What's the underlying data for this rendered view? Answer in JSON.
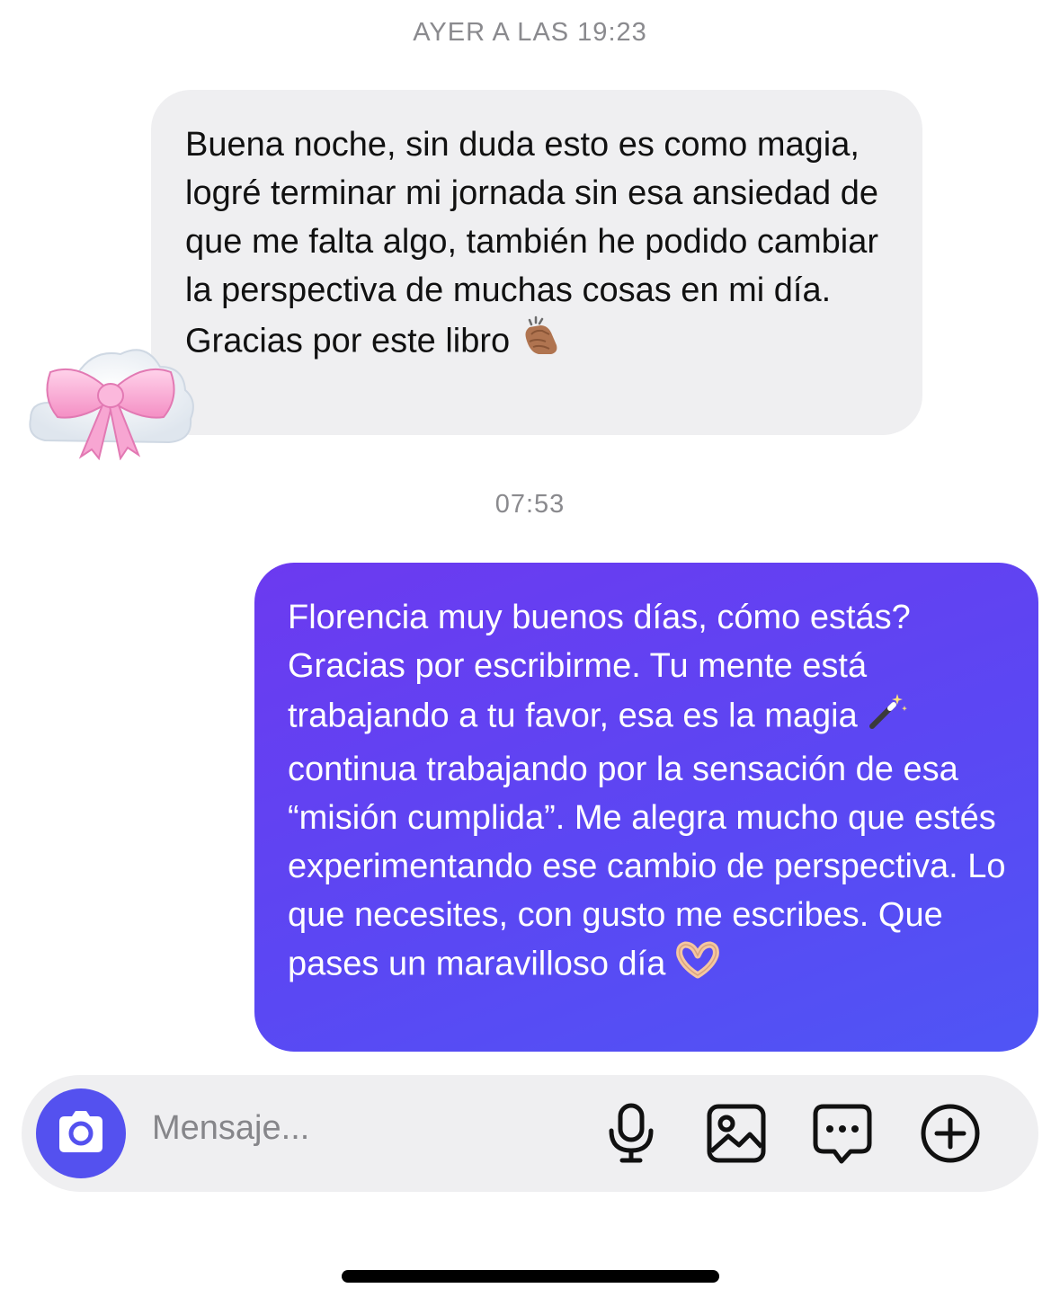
{
  "thread": {
    "timestamp_1": "AYER A LAS 19:23",
    "timestamp_2": "07:53"
  },
  "messages": [
    {
      "direction": "incoming",
      "text": "Buena noche, sin duda esto es como magia, logré terminar mi jornada sin esa ansiedad de que me falta algo, también he podido cambiar la perspectiva de muchas cosas en mi día. Gracias por este libro",
      "trailing_emoji": "clapping-hands",
      "reaction": "bow-on-cloud"
    },
    {
      "direction": "outgoing",
      "text_1": "Florencia muy buenos días, cómo estás? Gracias por escribirme. Tu mente está trabajando a tu favor, esa es la magia",
      "inline_emoji": "magic-wand",
      "text_2": "continua trabajando por la sensación de esa “misión cumplida”. Me alegra mucho que estés experimentando ese cambio de perspectiva. Lo que necesites, con gusto me escribes. Que pases un maravilloso día",
      "trailing_emoji": "heart-hands"
    }
  ],
  "composer": {
    "placeholder": "Mensaje...",
    "icons": [
      "camera-icon",
      "microphone-icon",
      "gallery-icon",
      "sticker-icon",
      "plus-icon"
    ]
  },
  "colors": {
    "incoming_bubble": "#efeff1",
    "outgoing_gradient_start": "#6c3af0",
    "outgoing_gradient_end": "#4f55f5",
    "camera_button": "#5451ef",
    "timestamp": "#8a8a8e"
  }
}
